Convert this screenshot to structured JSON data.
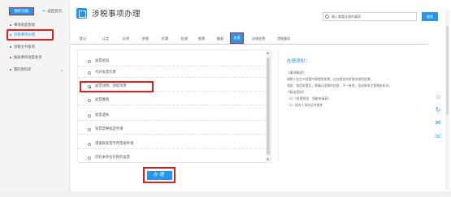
{
  "sidebar": {
    "head_label": "我的功能",
    "back_label": "返回首页",
    "items": [
      {
        "label": "事项进度管理",
        "active": false
      },
      {
        "label": "涉税事项办理",
        "active": true
      },
      {
        "label": "涉税文书查询",
        "active": false
      },
      {
        "label": "报表事项进度查询",
        "active": false
      },
      {
        "label": "我的资料库",
        "active": false
      }
    ]
  },
  "header": {
    "title": "涉税事项办理",
    "search_placeholder": "输入需要办理的事项",
    "search_button": "搜索"
  },
  "tabs": [
    {
      "label": "登记",
      "active": false
    },
    {
      "label": "认定",
      "active": false
    },
    {
      "label": "证明",
      "active": false
    },
    {
      "label": "申报",
      "active": false
    },
    {
      "label": "优惠",
      "active": false
    },
    {
      "label": "征收",
      "active": false
    },
    {
      "label": "税票",
      "active": false
    },
    {
      "label": "稽查",
      "active": false
    },
    {
      "label": "发票",
      "active": true
    },
    {
      "label": "法律追责",
      "active": false
    },
    {
      "label": "涉税服务",
      "active": false
    }
  ],
  "options": [
    {
      "label": "发票验旧",
      "checked": false
    },
    {
      "label": "代开发票作废",
      "checked": false
    },
    {
      "label": "发票领用、领取领用",
      "checked": true
    },
    {
      "label": "发票缴销",
      "checked": false
    },
    {
      "label": "发票遗失",
      "checked": false
    },
    {
      "label": "发票票种核定申请",
      "checked": false
    },
    {
      "label": "增值税发票专用票据申请",
      "checked": false
    },
    {
      "label": "印有本单位名称的发票"
    }
  ],
  "guide": {
    "title": "办理须知：",
    "lines": [
      "【事项概述】",
      "纳税人在生产经营中需使用发票，应在规定的时限内领用发票。",
      "领取、领用发票后，需确认发票的信息，不一致的，及时联系主管税务机关。",
      "【报送资料】",
      "（1）《发票领用、领取申请表》",
      "（2）经办人身份证件原件"
    ]
  },
  "submit_label": "办理",
  "float_icons": [
    "star-icon",
    "refresh-icon",
    "message-icon",
    "phone-icon"
  ]
}
